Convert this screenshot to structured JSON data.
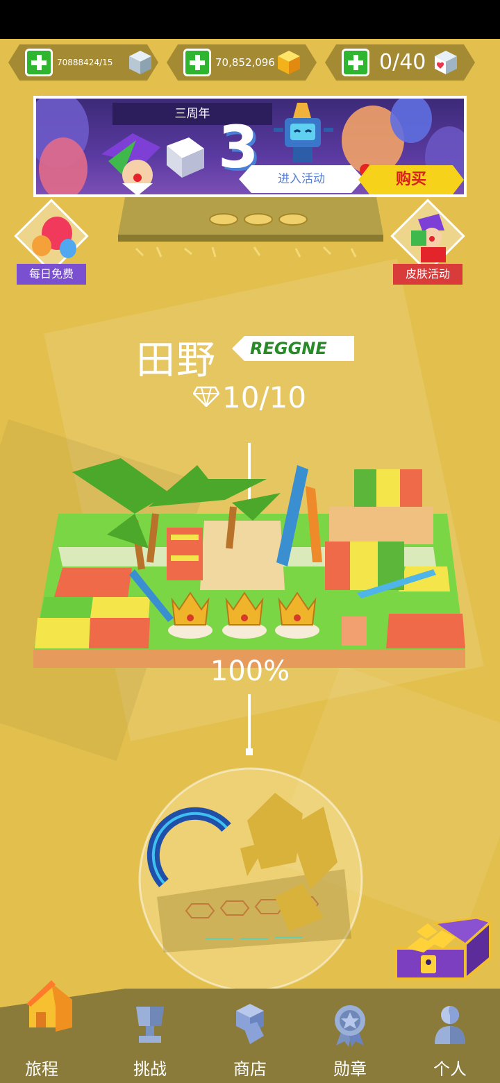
{
  "currencies": [
    {
      "value": "70888424/15",
      "icon": "silver-cube-icon"
    },
    {
      "value": "70,852,096",
      "icon": "gold-cube-icon"
    },
    {
      "value": "0/40",
      "icon": "heart-cube-icon"
    }
  ],
  "banner": {
    "tag": "三周年",
    "big_number": "3",
    "enter_label": "进入活动",
    "buy_label": "购买"
  },
  "side_buttons": {
    "daily_free": "每日免费",
    "skin_event": "皮肤活动"
  },
  "level": {
    "name": "田野",
    "tag": "REGGNE",
    "progress": "10/10",
    "percent": "100%"
  },
  "nav": [
    {
      "label": "旅程",
      "icon": "house-icon"
    },
    {
      "label": "挑战",
      "icon": "trophy-icon"
    },
    {
      "label": "商店",
      "icon": "shop-icon"
    },
    {
      "label": "勋章",
      "icon": "medal-icon"
    },
    {
      "label": "个人",
      "icon": "person-icon"
    }
  ],
  "colors": {
    "background": "#e3c04e",
    "plus_green": "#2fb52f",
    "buy_yellow": "#f6d21a",
    "buy_red": "#d8201c"
  }
}
